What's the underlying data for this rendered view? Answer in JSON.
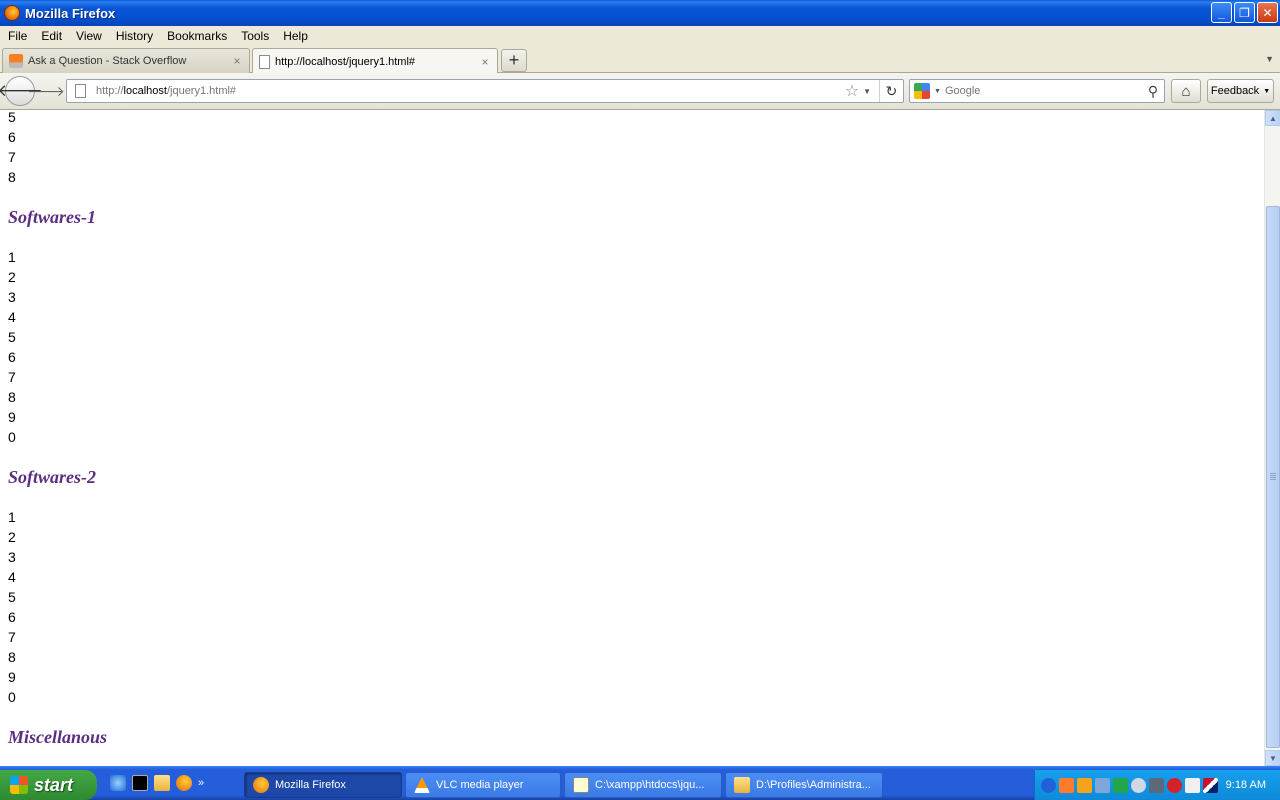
{
  "window": {
    "title": "Mozilla Firefox",
    "minimize": "_",
    "restore": "❐",
    "close": "✕"
  },
  "menu": [
    "File",
    "Edit",
    "View",
    "History",
    "Bookmarks",
    "Tools",
    "Help"
  ],
  "tabs": [
    {
      "label": "Ask a Question - Stack Overflow",
      "close": "×"
    },
    {
      "label": "http://localhost/jquery1.html#",
      "close": "×"
    }
  ],
  "newtab": "+",
  "tablist": "▼",
  "nav": {
    "back": "🡐",
    "forward": "🡒",
    "url_prefix": "http://",
    "url_host": "localhost",
    "url_path": "/jquery1.html#",
    "star": "☆",
    "drop": "▼",
    "reload": "↻",
    "search_placeholder": "Google",
    "search_go": "⚲",
    "home": "⌂",
    "feedback": "Feedback",
    "feedback_caret": "▼"
  },
  "content": {
    "top_numbers": [
      "5",
      "6",
      "7",
      "8"
    ],
    "sections": [
      {
        "heading": "Softwares-1",
        "numbers": [
          "1",
          "2",
          "3",
          "4",
          "5",
          "6",
          "7",
          "8",
          "9",
          "0"
        ]
      },
      {
        "heading": "Softwares-2",
        "numbers": [
          "1",
          "2",
          "3",
          "4",
          "5",
          "6",
          "7",
          "8",
          "9",
          "0"
        ]
      },
      {
        "heading": "Miscellanous",
        "numbers": []
      }
    ]
  },
  "scrollbar": {
    "up": "▲",
    "down": "▼"
  },
  "taskbar": {
    "start": "start",
    "ql_more": "»",
    "tasks": [
      "Mozilla Firefox",
      "VLC media player",
      "C:\\xampp\\htdocs\\jqu...",
      "D:\\Profiles\\Administra..."
    ],
    "clock": "9:18 AM"
  }
}
